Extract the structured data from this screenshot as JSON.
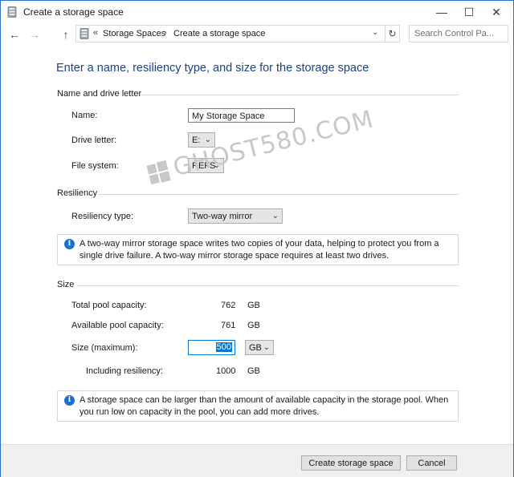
{
  "window": {
    "title": "Create a storage space",
    "controls": {
      "minimize": "—",
      "maximize": "☐",
      "close": "✕"
    }
  },
  "toolbar": {
    "back": "←",
    "forward": "→",
    "up": "↑",
    "address_chevron": "«",
    "breadcrumbs": [
      "Storage Spaces",
      "Create a storage space"
    ],
    "crumb_separator": "›",
    "address_dropdown": "⌄",
    "refresh": "↻",
    "search_placeholder": "Search Control Pa..."
  },
  "main": {
    "heading": "Enter a name, resiliency type, and size for the storage space"
  },
  "name_group": {
    "title": "Name and drive letter",
    "name_label": "Name:",
    "name_value": "My Storage Space",
    "drive_label": "Drive letter:",
    "drive_value": "E:",
    "fs_label": "File system:",
    "fs_value": "REFS"
  },
  "resiliency_group": {
    "title": "Resiliency",
    "type_label": "Resiliency type:",
    "type_value": "Two-way mirror",
    "info": "A two-way mirror storage space writes two copies of your data, helping to protect you from a single drive failure. A two-way mirror storage space requires at least two drives."
  },
  "size_group": {
    "title": "Size",
    "total_label": "Total pool capacity:",
    "total_value": "762",
    "total_unit": "GB",
    "available_label": "Available pool capacity:",
    "available_value": "761",
    "available_unit": "GB",
    "size_label": "Size (maximum):",
    "size_value": "500",
    "size_unit": "GB",
    "including_label": "Including resiliency:",
    "including_value": "1000",
    "including_unit": "GB",
    "info": "A storage space can be larger than the amount of available capacity in the storage pool. When you run low on capacity in the pool, you can add more drives."
  },
  "footer": {
    "create_label": "Create storage space",
    "cancel_label": "Cancel"
  },
  "watermark": {
    "text": "GHOST580.COM"
  },
  "colors": {
    "heading": "#1e3f8a",
    "info_icon": "#1c6fd6",
    "selection": "#0078d7",
    "window_border": "#2b6fcc"
  }
}
